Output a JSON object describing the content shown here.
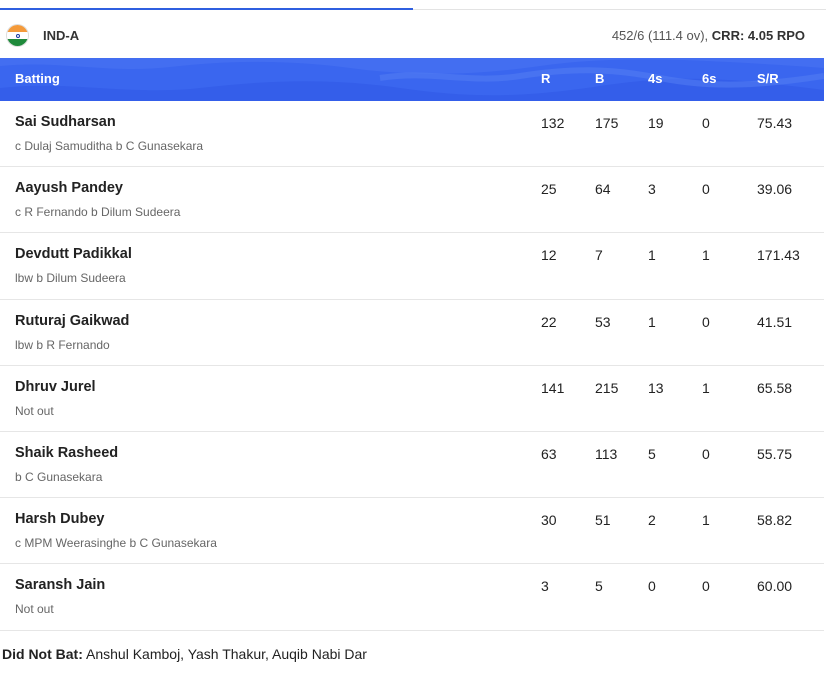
{
  "team": {
    "name": "IND-A",
    "score": "452/6 (111.4 ov),",
    "crr": "CRR: 4.05 RPO",
    "flag_icon": "india-flag-icon"
  },
  "columns": {
    "batting": "Batting",
    "r": "R",
    "b": "B",
    "fours": "4s",
    "sixes": "6s",
    "sr": "S/R"
  },
  "batters": [
    {
      "name": "Sai Sudharsan",
      "dismissal": "c Dulaj Samuditha b C Gunasekara",
      "r": "132",
      "b": "175",
      "fours": "19",
      "sixes": "0",
      "sr": "75.43"
    },
    {
      "name": "Aayush Pandey",
      "dismissal": "c R Fernando b Dilum Sudeera",
      "r": "25",
      "b": "64",
      "fours": "3",
      "sixes": "0",
      "sr": "39.06"
    },
    {
      "name": "Devdutt Padikkal",
      "dismissal": "lbw b Dilum Sudeera",
      "r": "12",
      "b": "7",
      "fours": "1",
      "sixes": "1",
      "sr": "171.43"
    },
    {
      "name": "Ruturaj Gaikwad",
      "dismissal": "lbw b R Fernando",
      "r": "22",
      "b": "53",
      "fours": "1",
      "sixes": "0",
      "sr": "41.51"
    },
    {
      "name": "Dhruv Jurel",
      "dismissal": "Not out",
      "r": "141",
      "b": "215",
      "fours": "13",
      "sixes": "1",
      "sr": "65.58"
    },
    {
      "name": "Shaik Rasheed",
      "dismissal": "b C Gunasekara",
      "r": "63",
      "b": "113",
      "fours": "5",
      "sixes": "0",
      "sr": "55.75"
    },
    {
      "name": "Harsh Dubey",
      "dismissal": "c MPM Weerasinghe b C Gunasekara",
      "r": "30",
      "b": "51",
      "fours": "2",
      "sixes": "1",
      "sr": "58.82"
    },
    {
      "name": "Saransh Jain",
      "dismissal": "Not out",
      "r": "3",
      "b": "5",
      "fours": "0",
      "sixes": "0",
      "sr": "60.00"
    }
  ],
  "did_not_bat": {
    "label": "Did Not Bat:",
    "players": "Anshul Kamboj, Yash Thakur, Auqib Nabi Dar"
  },
  "colors": {
    "header_bg": "#3a66ef",
    "active_tab_line": "#2f5fe0"
  }
}
